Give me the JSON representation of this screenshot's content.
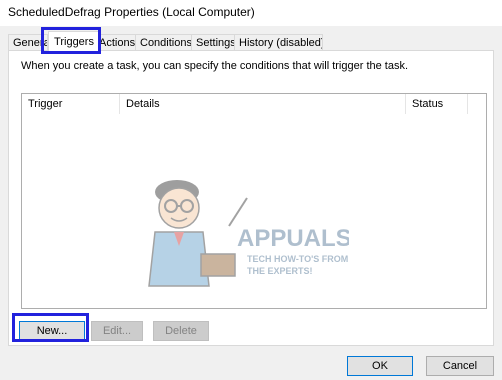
{
  "window": {
    "title": "ScheduledDefrag Properties (Local Computer)"
  },
  "tabs": [
    {
      "label": "General"
    },
    {
      "label": "Triggers",
      "active": true
    },
    {
      "label": "Actions"
    },
    {
      "label": "Conditions"
    },
    {
      "label": "Settings"
    },
    {
      "label": "History (disabled)"
    }
  ],
  "panel": {
    "description": "When you create a task, you can specify the conditions that will trigger the task."
  },
  "list": {
    "columns": [
      "Trigger",
      "Details",
      "Status"
    ],
    "rows": []
  },
  "buttons": {
    "new": "New...",
    "edit": "Edit...",
    "delete": "Delete",
    "ok": "OK",
    "cancel": "Cancel"
  },
  "watermark": {
    "brand": "APPUALS",
    "tagline_1": "TECH HOW-TO'S FROM",
    "tagline_2": "THE EXPERTS!"
  },
  "colors": {
    "highlight": "#2222dd",
    "accent": "#0078d7"
  }
}
